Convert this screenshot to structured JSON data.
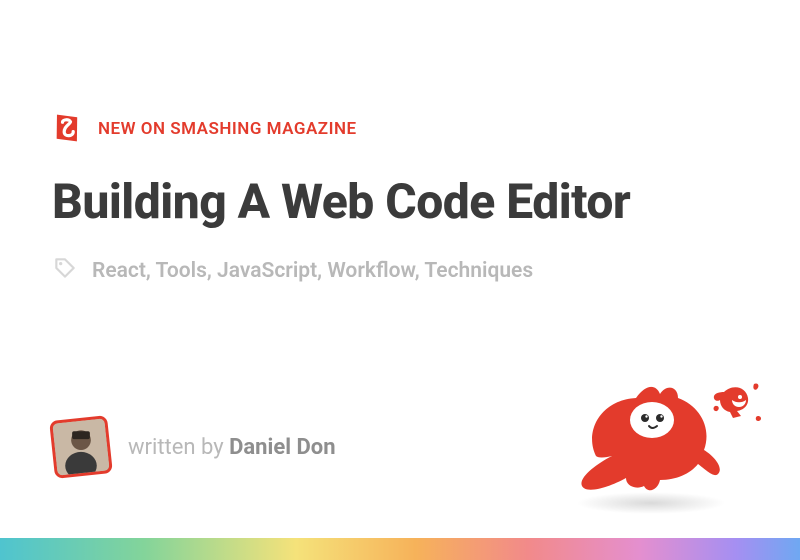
{
  "kicker": {
    "logo_name": "smashing-logo",
    "text": "NEW ON SMASHING MAGAZINE"
  },
  "title": "Building A Web Code Editor",
  "tags": {
    "icon_name": "tag-icon",
    "list_text": "React, Tools, JavaScript, Workflow, Techniques"
  },
  "byline": {
    "prefix": "written by ",
    "author": "Daniel Don"
  },
  "mascot": {
    "name": "smashing-cat-bird"
  },
  "colors": {
    "brand": "#e33b2c",
    "text_dark": "#3b3b3b",
    "text_muted": "#b8b8b8"
  }
}
